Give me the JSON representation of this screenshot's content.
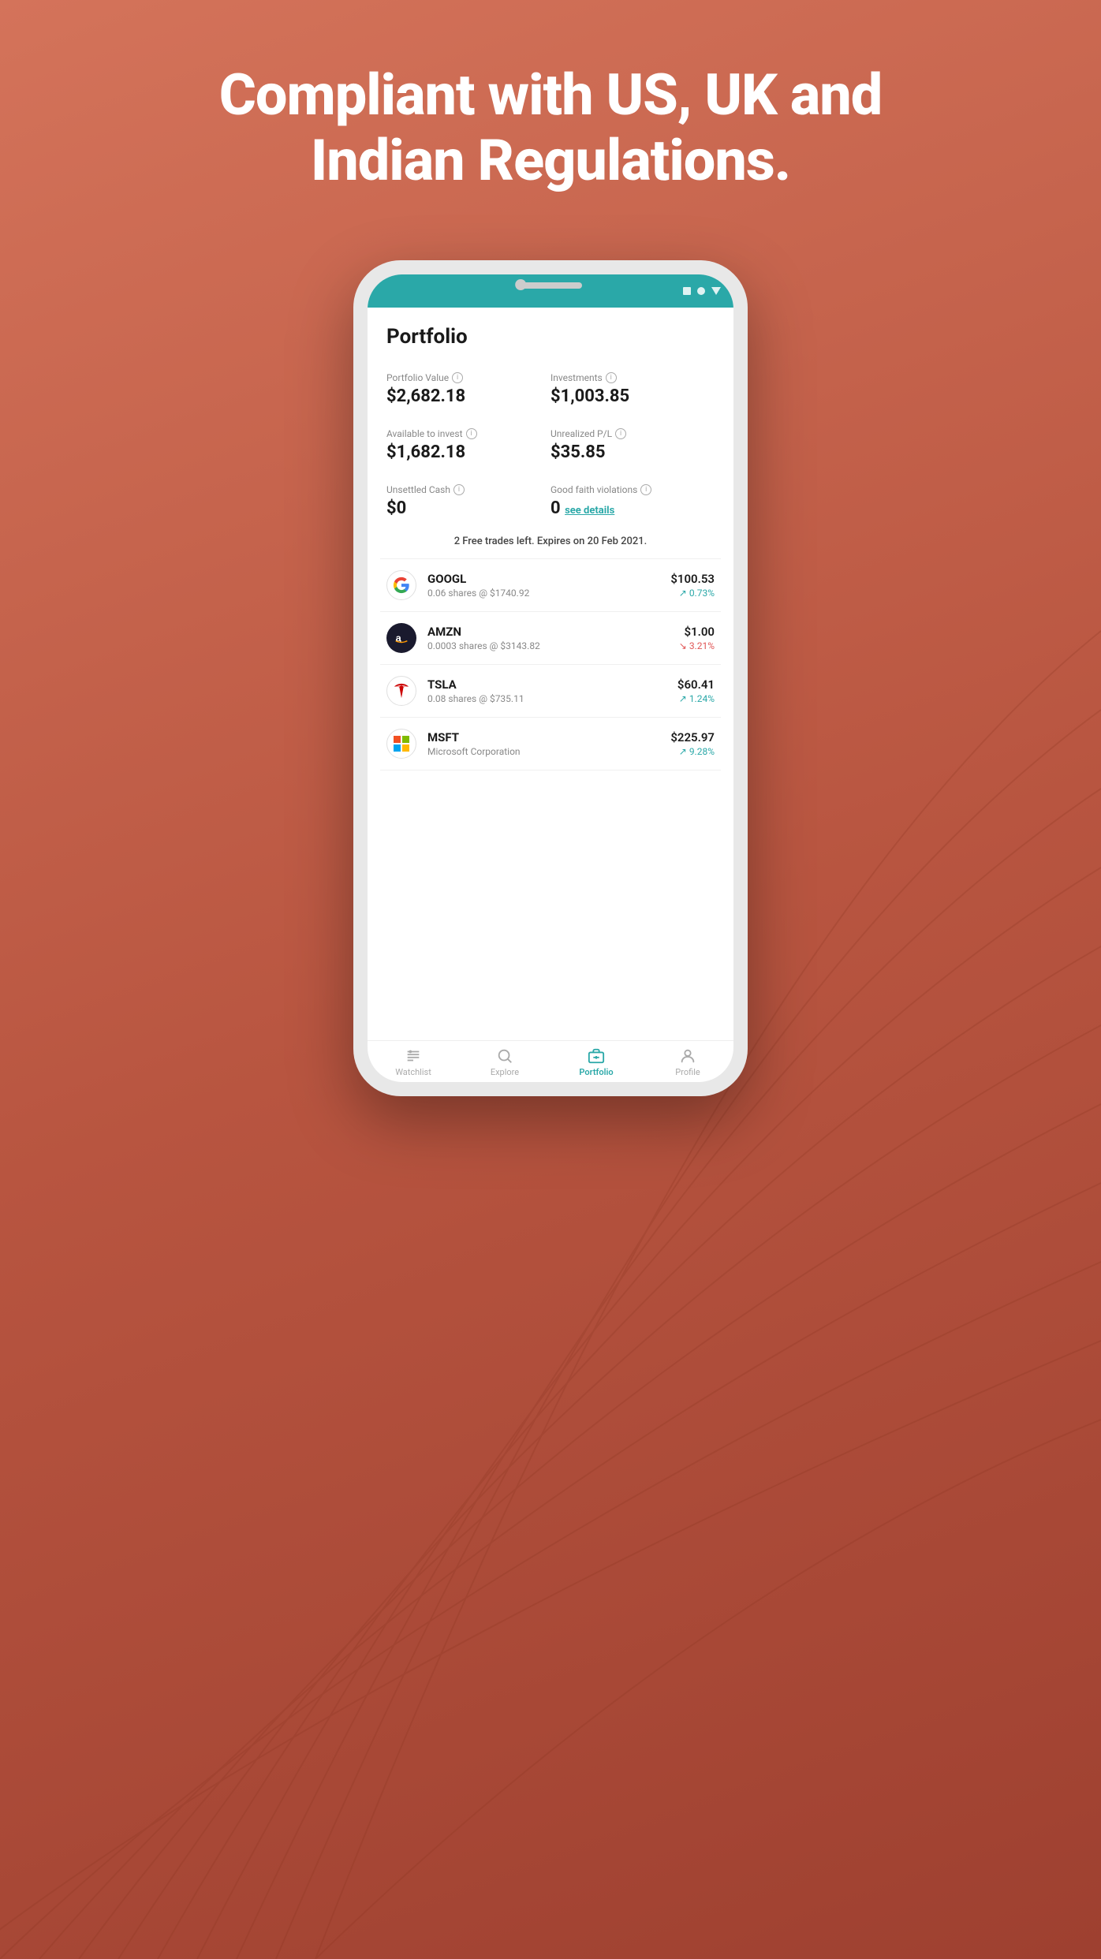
{
  "headline": {
    "line1": "Compliant with US, UK and",
    "line2": "Indian Regulations."
  },
  "status_bar": {
    "icons": [
      "square",
      "circle",
      "triangle"
    ]
  },
  "portfolio": {
    "title": "Portfolio",
    "stats": [
      {
        "label": "Portfolio Value",
        "value": "$2,682.18",
        "col": "left"
      },
      {
        "label": "Investments",
        "value": "$1,003.85",
        "col": "right"
      },
      {
        "label": "Available to invest",
        "value": "$1,682.18",
        "col": "left"
      },
      {
        "label": "Unrealized P/L",
        "value": "$35.85",
        "col": "right"
      },
      {
        "label": "Unsettled Cash",
        "value": "$0",
        "col": "left"
      },
      {
        "label": "Good faith violations",
        "value": "0",
        "col": "right",
        "link": "see details"
      }
    ],
    "free_trades": "2 Free trades left. Expires on 20 Feb 2021."
  },
  "stocks": [
    {
      "symbol": "GOOGL",
      "shares": "0.06 shares @ $1740.92",
      "price": "$100.53",
      "change": "0.73%",
      "direction": "up",
      "logo_type": "google"
    },
    {
      "symbol": "AMZN",
      "shares": "0.0003 shares @ $3143.82",
      "price": "$1.00",
      "change": "3.21%",
      "direction": "down",
      "logo_type": "amazon"
    },
    {
      "symbol": "TSLA",
      "shares": "0.08 shares @ $735.11",
      "price": "$60.41",
      "change": "1.24%",
      "direction": "up",
      "logo_type": "tesla"
    },
    {
      "symbol": "MSFT",
      "shares": "Microsoft Corporation",
      "price": "$225.97",
      "change": "9.28%",
      "direction": "up",
      "logo_type": "msft"
    }
  ],
  "nav": {
    "items": [
      {
        "label": "Watchlist",
        "icon": "watchlist",
        "active": false
      },
      {
        "label": "Explore",
        "icon": "explore",
        "active": false
      },
      {
        "label": "Portfolio",
        "icon": "portfolio",
        "active": true
      },
      {
        "label": "Profile",
        "icon": "profile",
        "active": false
      }
    ]
  }
}
